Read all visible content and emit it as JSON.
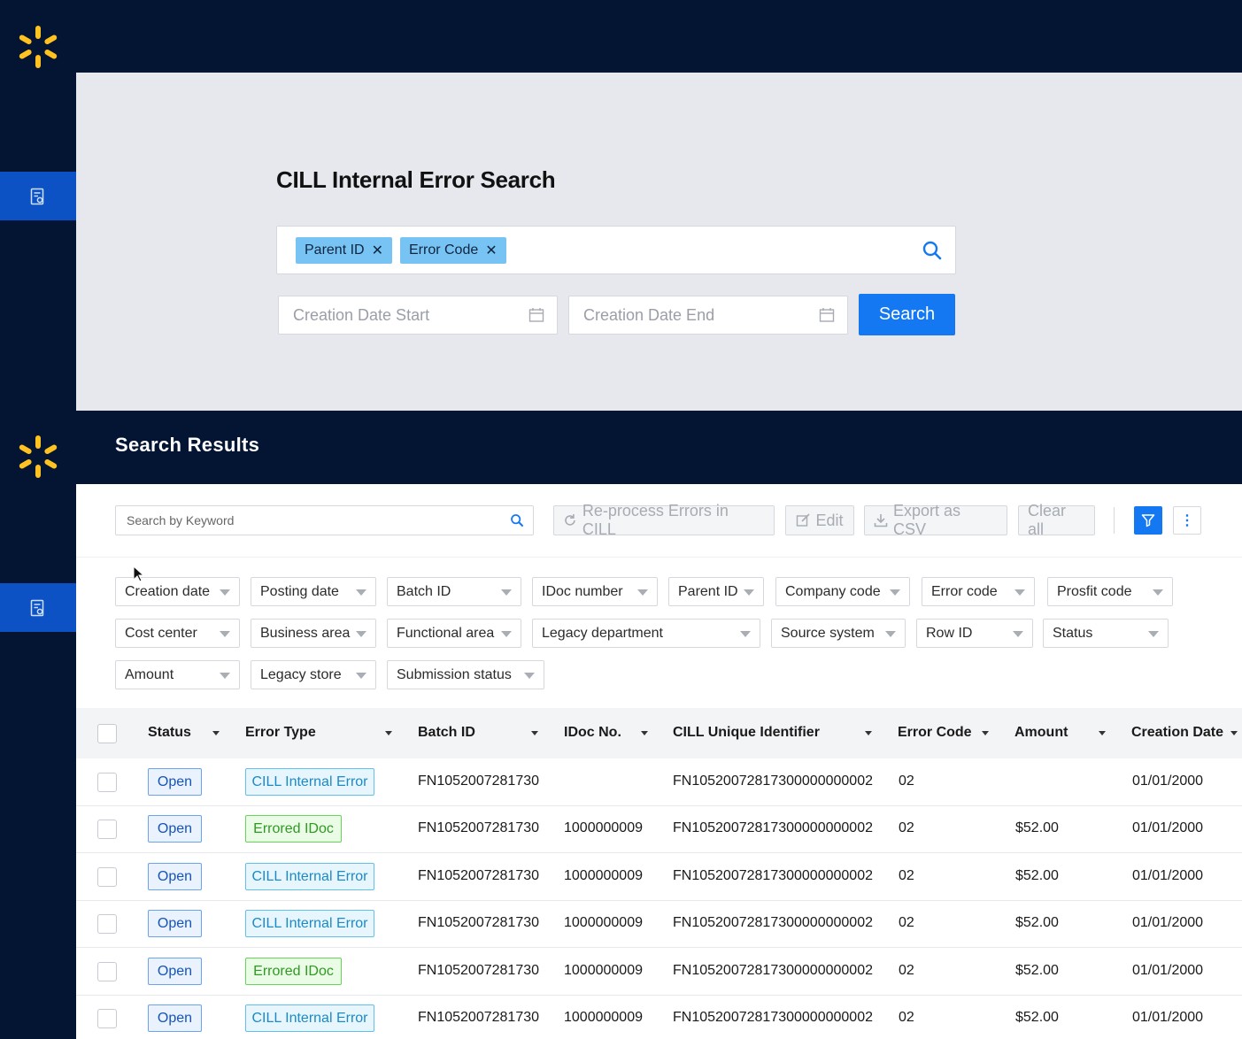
{
  "nav": {
    "logo_icon": "spark-logo",
    "item_icon": "document-report-icon",
    "active_color": "#0c52c4",
    "brand_color": "#ffc220"
  },
  "search": {
    "title": "CILL Internal Error Search",
    "chips": [
      {
        "label": "Parent ID"
      },
      {
        "label": "Error Code"
      }
    ],
    "date_start_placeholder": "Creation Date Start",
    "date_end_placeholder": "Creation Date End",
    "search_button": "Search"
  },
  "results": {
    "title": "Search Results",
    "keyword_placeholder": "Search by Keyword",
    "actions": {
      "reprocess": "Re-process Errors in CILL",
      "edit": "Edit",
      "export": "Export as CSV",
      "clear": "Clear all"
    },
    "filters": [
      "Creation date",
      "Posting date",
      "Batch ID",
      "IDoc number",
      "Parent ID",
      "Company code",
      "Error code",
      "Prosfit code",
      "Cost center",
      "Business area",
      "Functional area",
      "Legacy department",
      "Source system",
      "Row ID",
      "Status",
      "Amount",
      "Legacy store",
      "Submission status"
    ],
    "columns": [
      "Status",
      "Error Type",
      "Batch ID",
      "IDoc No.",
      "CILL Unique Identifier",
      "Error Code",
      "Amount",
      "Creation Date"
    ],
    "rows": [
      {
        "status": "Open",
        "error_type": "CILL Internal Error",
        "type_kind": "cill",
        "batch_id": "FN1052007281730",
        "idoc": "",
        "uid": "FN10520072817300000000002",
        "error_code": "02",
        "amount": "",
        "date": "01/01/2000"
      },
      {
        "status": "Open",
        "error_type": "Errored IDoc",
        "type_kind": "idoc",
        "batch_id": "FN1052007281730",
        "idoc": "1000000009",
        "uid": "FN10520072817300000000002",
        "error_code": "02",
        "amount": "$52.00",
        "date": "01/01/2000"
      },
      {
        "status": "Open",
        "error_type": "CILL Internal Error",
        "type_kind": "cill",
        "batch_id": "FN1052007281730",
        "idoc": "1000000009",
        "uid": "FN10520072817300000000002",
        "error_code": "02",
        "amount": "$52.00",
        "date": "01/01/2000"
      },
      {
        "status": "Open",
        "error_type": "CILL Internal Error",
        "type_kind": "cill",
        "batch_id": "FN1052007281730",
        "idoc": "1000000009",
        "uid": "FN10520072817300000000002",
        "error_code": "02",
        "amount": "$52.00",
        "date": "01/01/2000"
      },
      {
        "status": "Open",
        "error_type": "Errored IDoc",
        "type_kind": "idoc",
        "batch_id": "FN1052007281730",
        "idoc": "1000000009",
        "uid": "FN10520072817300000000002",
        "error_code": "02",
        "amount": "$52.00",
        "date": "01/01/2000"
      },
      {
        "status": "Open",
        "error_type": "CILL Internal Error",
        "type_kind": "cill",
        "batch_id": "FN1052007281730",
        "idoc": "1000000009",
        "uid": "FN10520072817300000000002",
        "error_code": "02",
        "amount": "$52.00",
        "date": "01/01/2000"
      }
    ]
  }
}
